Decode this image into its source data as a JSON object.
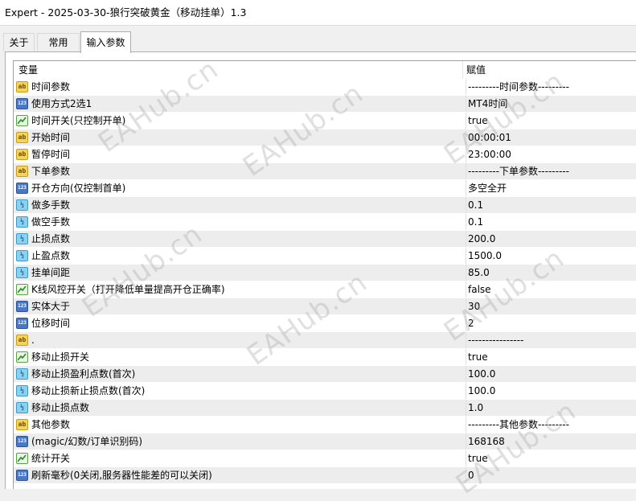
{
  "window": {
    "title": "Expert - 2025-03-30-狼行突破黄金（移动挂单）1.3"
  },
  "tabs": [
    {
      "label": "关于",
      "active": false
    },
    {
      "label": "常用",
      "active": false
    },
    {
      "label": "输入参数",
      "active": true
    }
  ],
  "table": {
    "headers": {
      "variable": "变量",
      "value": "赋值"
    },
    "rows": [
      {
        "type": "ab",
        "name": "时间参数",
        "value": "---------时间参数---------"
      },
      {
        "type": "int",
        "name": "使用方式2选1",
        "value": "MT4时间"
      },
      {
        "type": "bool",
        "name": "时间开关(只控制开单)",
        "value": "true"
      },
      {
        "type": "ab",
        "name": "开始时间",
        "value": "00:00:01"
      },
      {
        "type": "ab",
        "name": "暂停时间",
        "value": "23:00:00"
      },
      {
        "type": "ab",
        "name": "下单参数",
        "value": "---------下单参数---------"
      },
      {
        "type": "int",
        "name": "开仓方向(仅控制首单)",
        "value": "多空全开"
      },
      {
        "type": "dbl",
        "name": "做多手数",
        "value": "0.1"
      },
      {
        "type": "dbl",
        "name": "做空手数",
        "value": "0.1"
      },
      {
        "type": "dbl",
        "name": "止损点数",
        "value": "200.0"
      },
      {
        "type": "dbl",
        "name": "止盈点数",
        "value": "1500.0"
      },
      {
        "type": "dbl",
        "name": "挂单间距",
        "value": "85.0"
      },
      {
        "type": "bool",
        "name": "K线风控开关（打开降低单量提高开仓正确率)",
        "value": "false"
      },
      {
        "type": "int",
        "name": "实体大于",
        "value": "30"
      },
      {
        "type": "int",
        "name": "位移时间",
        "value": "2"
      },
      {
        "type": "ab",
        "name": ".",
        "value": "----------------"
      },
      {
        "type": "bool",
        "name": "移动止损开关",
        "value": "true"
      },
      {
        "type": "dbl",
        "name": "移动止损盈利点数(首次)",
        "value": "100.0"
      },
      {
        "type": "dbl",
        "name": "移动止损新止损点数(首次)",
        "value": "100.0"
      },
      {
        "type": "dbl",
        "name": "移动止损点数",
        "value": "1.0"
      },
      {
        "type": "ab",
        "name": "其他参数",
        "value": "---------其他参数---------"
      },
      {
        "type": "int",
        "name": "(magic/幻数/订单识别码)",
        "value": "168168"
      },
      {
        "type": "bool",
        "name": "统计开关",
        "value": "true"
      },
      {
        "type": "int",
        "name": "刷新毫秒(0关闭,服务器性能差的可以关闭)",
        "value": "0"
      }
    ]
  },
  "icons": {
    "ab": "string-param-icon",
    "int": "integer-param-icon",
    "dbl": "double-param-icon",
    "bool": "bool-param-icon"
  },
  "watermark": {
    "text": "EAHub.cn"
  }
}
